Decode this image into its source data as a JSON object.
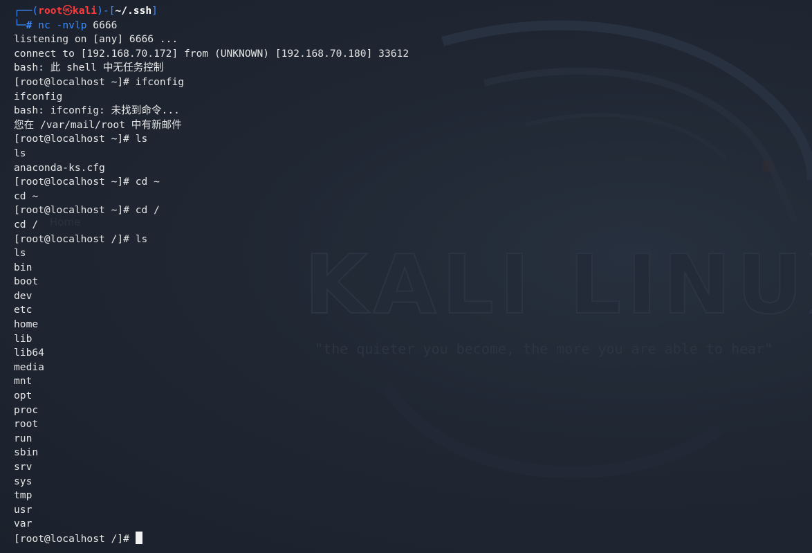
{
  "prompt": {
    "frame_top": "┌──(",
    "user": "root",
    "skull": "㉿",
    "host": "kali",
    "sep": ")-[",
    "dir": "~/.ssh",
    "close": "]",
    "frame_bottom": "└─",
    "hash": "#",
    "cmd": "nc",
    "flags": "-nvlp",
    "port": "6666"
  },
  "output_lines": [
    "listening on [any] 6666 ...",
    "connect to [192.168.70.172] from (UNKNOWN) [192.168.70.180] 33612",
    "bash: 此 shell 中无任务控制",
    "[root@localhost ~]# ifconfig",
    "ifconfig",
    "bash: ifconfig: 未找到命令...",
    "您在 /var/mail/root 中有新邮件",
    "[root@localhost ~]# ls",
    "ls",
    "anaconda-ks.cfg",
    "[root@localhost ~]# cd ~",
    "cd ~",
    "[root@localhost ~]# cd /",
    "cd /",
    "[root@localhost /]# ls",
    "ls",
    "bin",
    "boot",
    "dev",
    "etc",
    "home",
    "lib",
    "lib64",
    "media",
    "mnt",
    "opt",
    "proc",
    "root",
    "run",
    "sbin",
    "srv",
    "sys",
    "tmp",
    "usr",
    "var"
  ],
  "current_prompt": "[root@localhost /]# ",
  "wallpaper": {
    "brand": "KALI LINUX",
    "tagline": "\"the quieter you become, the more you are able to hear\"",
    "desktop_icon_label": "Home"
  },
  "colors": {
    "background": "#1f2531",
    "text": "#e6e6e6",
    "prompt_blue": "#3c8cff",
    "prompt_red": "#ff3b3b"
  }
}
